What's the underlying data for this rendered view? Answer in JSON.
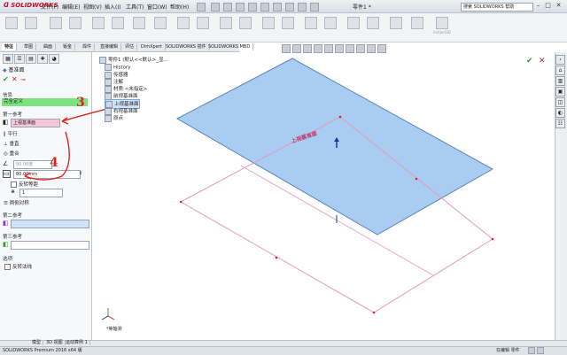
{
  "app": {
    "logo": "SOLIDWORKS",
    "doc_title": "零件1 *",
    "search_placeholder": "搜索 SOLIDWORKS 帮助"
  },
  "menu": [
    "文件(F)",
    "编辑(E)",
    "视图(V)",
    "插入(I)",
    "工具(T)",
    "窗口(W)",
    "帮助(H)"
  ],
  "toolbar": {
    "items": [
      "",
      "",
      "",
      "",
      "",
      "",
      "",
      "",
      "",
      "",
      "",
      "",
      "",
      "",
      "",
      "",
      "",
      "",
      "",
      "",
      "Instant3D"
    ]
  },
  "tabs": [
    "特征",
    "草图",
    "曲面",
    "钣金",
    "焊件",
    "直接编辑",
    "评估",
    "DimXpert",
    "SOLIDWORKS 插件",
    "SOLIDWORKS MBD"
  ],
  "propertymanager": {
    "title": "基准面",
    "message_header": "信息",
    "message_text": "完全定义",
    "first_ref_header": "第一参考",
    "first_ref_value": "上视基准面",
    "first_ref_options": [
      "平行",
      "垂直",
      "重合"
    ],
    "angle_value": "90.00度",
    "offset_value": "80.00mm",
    "flip_offset_label": "反转等距",
    "count_value": "1",
    "mid_plane_label": "两侧对称",
    "second_ref_header": "第二参考",
    "third_ref_header": "第三参考",
    "options_header": "选项",
    "flip_normal_label": "反转法线"
  },
  "annotations": {
    "step3": "3",
    "step4": "4"
  },
  "feature_tree": {
    "root": "零件1 (默认<<默认>_显...",
    "items": [
      "History",
      "传感器",
      "注解",
      "材质 <未指定>",
      "前视基准面",
      "上视基准面",
      "右视基准面",
      "原点"
    ]
  },
  "view": {
    "plane_label": "上视基准面",
    "view_orientation": "*等轴测"
  },
  "bottom_tabs": [
    "模型",
    "3D 视图",
    "运动算例 1"
  ],
  "status": {
    "left": "SOLIDWORKS Premium 2016 x64 版",
    "right": "在编辑 零件"
  }
}
